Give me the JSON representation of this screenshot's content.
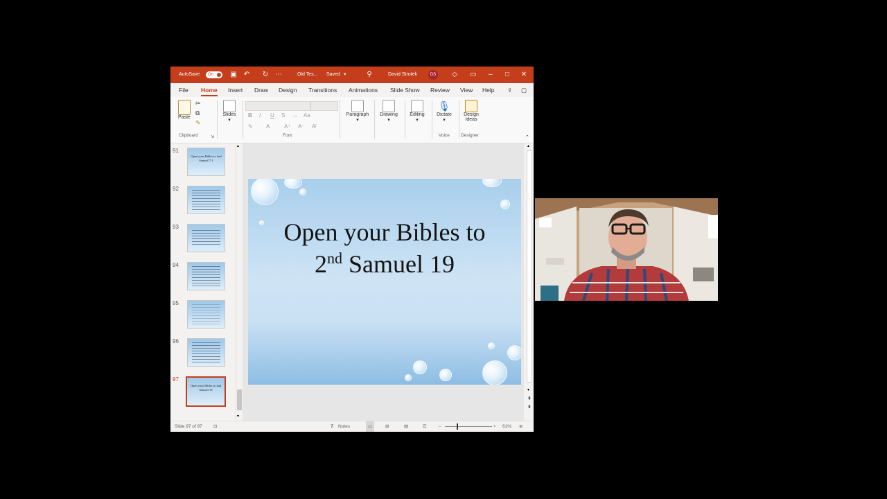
{
  "titlebar": {
    "autosave_label": "AutoSave",
    "autosave_state": "On",
    "doc_name": "Old Tes...",
    "save_status": "Saved",
    "user_name": "David Strotek",
    "user_initials": "DS"
  },
  "menu": {
    "tabs": [
      "File",
      "Home",
      "Insert",
      "Draw",
      "Design",
      "Transitions",
      "Animations",
      "Slide Show",
      "Review",
      "View",
      "Help"
    ],
    "active": "Home"
  },
  "ribbon": {
    "paste": "Paste",
    "slides": "Slides",
    "paragraph": "Paragraph",
    "drawing": "Drawing",
    "editing": "Editing",
    "dictate": "Dictate",
    "design_ideas_1": "Design",
    "design_ideas_2": "Ideas",
    "groups": {
      "clipboard": "Clipboard",
      "font": "Font",
      "voice": "Voice",
      "designer": "Designer"
    }
  },
  "thumbnails": [
    {
      "number": "91",
      "text": "Open your Bibles to 2nd Samuel 7-1"
    },
    {
      "number": "92",
      "text": ""
    },
    {
      "number": "93",
      "text": ""
    },
    {
      "number": "94",
      "text": ""
    },
    {
      "number": "95",
      "text": ""
    },
    {
      "number": "96",
      "text": ""
    },
    {
      "number": "97",
      "text": "Open your Bibles to 2nd Samuel 19",
      "selected": true
    }
  ],
  "slide": {
    "line1": "Open your Bibles to",
    "line2_pre": "2",
    "line2_sup": "nd",
    "line2_post": " Samuel 19"
  },
  "status": {
    "slide_counter": "Slide 97 of 97",
    "notes": "Notes",
    "zoom": "61%"
  },
  "colors": {
    "accent": "#c43e1c",
    "window_bg": "#f3f2f1",
    "backdrop": "#000000"
  }
}
